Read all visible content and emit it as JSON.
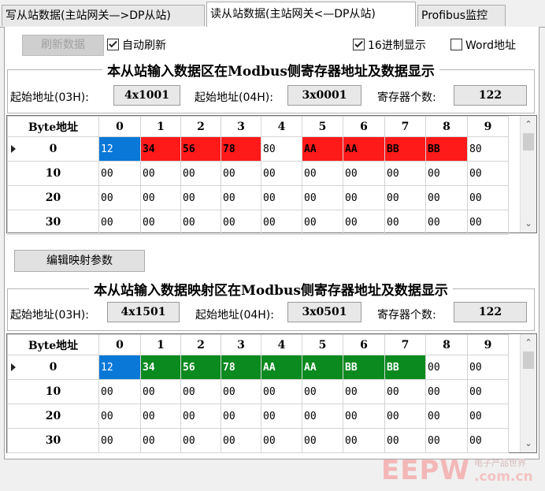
{
  "tabs": [
    "写从站数据(主站网关—>DP从站)",
    "读从站数据(主站网关<—DP从站)",
    "Profibus监控"
  ],
  "toolbar": {
    "refresh_label": "刷新数据",
    "auto_refresh_label": "自动刷新",
    "hex_label": "16进制显示",
    "word_label": "Word地址"
  },
  "section1": {
    "title": "本从站输入数据区在Modbus侧寄存器地址及数据显示",
    "start03_label": "起始地址(03H):",
    "start03_value": "4x1001",
    "start04_label": "起始地址(04H):",
    "start04_value": "3x0001",
    "count_label": "寄存器个数:",
    "count_value": "122",
    "header": [
      "Byte地址",
      "0",
      "1",
      "2",
      "3",
      "4",
      "5",
      "6",
      "7",
      "8",
      "9"
    ],
    "rows": [
      {
        "addr": "0",
        "cells": [
          "12",
          "34",
          "56",
          "78",
          "80",
          "AA",
          "AA",
          "BB",
          "BB",
          "80"
        ]
      },
      {
        "addr": "10",
        "cells": [
          "00",
          "00",
          "00",
          "00",
          "00",
          "00",
          "00",
          "00",
          "00",
          "00"
        ]
      },
      {
        "addr": "20",
        "cells": [
          "00",
          "00",
          "00",
          "00",
          "00",
          "00",
          "00",
          "00",
          "00",
          "00"
        ]
      },
      {
        "addr": "30",
        "cells": [
          "00",
          "00",
          "00",
          "00",
          "00",
          "00",
          "00",
          "00",
          "00",
          "00"
        ]
      }
    ]
  },
  "edit_button": "编辑映射参数",
  "section2": {
    "title": "本从站输入数据映射区在Modbus侧寄存器地址及数据显示",
    "start03_label": "起始地址(03H):",
    "start03_value": "4x1501",
    "start04_label": "起始地址(04H):",
    "start04_value": "3x0501",
    "count_label": "寄存器个数:",
    "count_value": "122",
    "header": [
      "Byte地址",
      "0",
      "1",
      "2",
      "3",
      "4",
      "5",
      "6",
      "7",
      "8",
      "9"
    ],
    "rows": [
      {
        "addr": "0",
        "cells": [
          "12",
          "34",
          "56",
          "78",
          "AA",
          "AA",
          "BB",
          "BB",
          "00",
          "00"
        ]
      },
      {
        "addr": "10",
        "cells": [
          "00",
          "00",
          "00",
          "00",
          "00",
          "00",
          "00",
          "00",
          "00",
          "00"
        ]
      },
      {
        "addr": "20",
        "cells": [
          "00",
          "00",
          "00",
          "00",
          "00",
          "00",
          "00",
          "00",
          "00",
          "00"
        ]
      },
      {
        "addr": "30",
        "cells": [
          "00",
          "00",
          "00",
          "00",
          "00",
          "00",
          "00",
          "00",
          "00",
          "00"
        ]
      }
    ]
  },
  "watermark": {
    "brand": "EEPW",
    "tagline": "电子产品世界",
    "domain": ".com.cn"
  },
  "colors": {
    "selected_blue": "#0a78d7",
    "highlight_red": "#ff1a1a",
    "highlight_green": "#0b8a1f"
  },
  "cell_highlights": {
    "section1": [
      "blue",
      "red",
      "red",
      "red",
      "none",
      "red",
      "red",
      "red",
      "red",
      "none"
    ],
    "section2": [
      "blue",
      "green",
      "green",
      "green",
      "green",
      "green",
      "green",
      "green",
      "none",
      "none"
    ]
  },
  "icons": [
    "row-indicator-icon",
    "scroll-up-icon",
    "scroll-down-icon",
    "checkbox-icon"
  ]
}
